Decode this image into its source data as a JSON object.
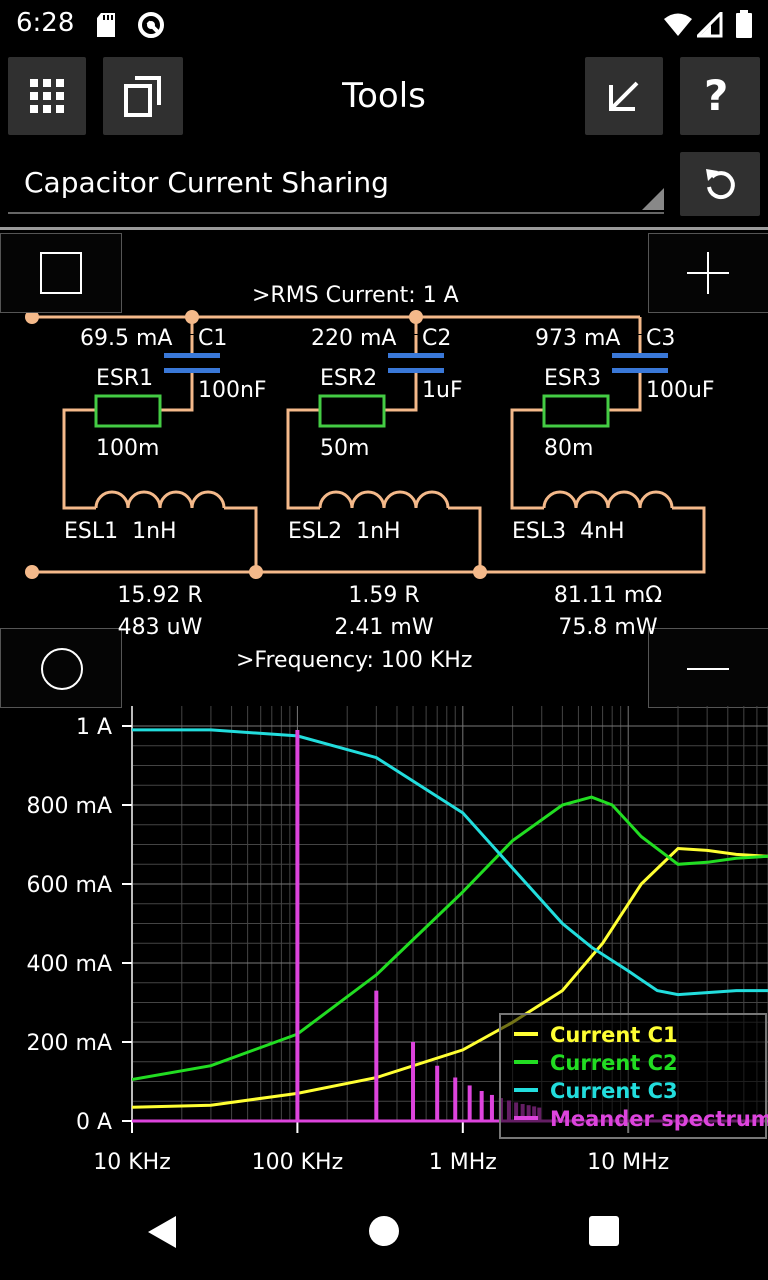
{
  "status_bar": {
    "time": "6:28"
  },
  "toolbar": {
    "title": "Tools"
  },
  "tool_select": {
    "value": "Capacitor Current Sharing"
  },
  "circuit": {
    "rms_current": ">RMS Current: 1 A",
    "frequency": ">Frequency: 100 KHz",
    "branches": [
      {
        "current": "69.5 mA",
        "cap_name": "C1",
        "cap_value": "100nF",
        "esr_name": "ESR1",
        "esr_value": "100m",
        "esl_label": "ESL1  1nH",
        "impedance": "15.92 R",
        "power": "483 uW"
      },
      {
        "current": "220 mA",
        "cap_name": "C2",
        "cap_value": "1uF",
        "esr_name": "ESR2",
        "esr_value": "50m",
        "esl_label": "ESL2  1nH",
        "impedance": "1.59 R",
        "power": "2.41 mW"
      },
      {
        "current": "973 mA",
        "cap_name": "C3",
        "cap_value": "100uF",
        "esr_name": "ESR3",
        "esr_value": "80m",
        "esl_label": "ESL3  4nH",
        "impedance": "81.11 mΩ",
        "power": "75.8 mW"
      }
    ]
  },
  "chart_data": {
    "type": "line",
    "x_scale": "log",
    "xlim": [
      10000,
      70000000
    ],
    "ylim": [
      0,
      1
    ],
    "x_ticks": [
      {
        "value": 10000,
        "label": "10 KHz"
      },
      {
        "value": 100000,
        "label": "100 KHz"
      },
      {
        "value": 1000000,
        "label": "1 MHz"
      },
      {
        "value": 10000000,
        "label": "10 MHz"
      }
    ],
    "y_ticks": [
      {
        "value": 0,
        "label": "0 A"
      },
      {
        "value": 0.2,
        "label": "200 mA"
      },
      {
        "value": 0.4,
        "label": "400 mA"
      },
      {
        "value": 0.6,
        "label": "600 mA"
      },
      {
        "value": 0.8,
        "label": "800 mA"
      },
      {
        "value": 1,
        "label": "1 A"
      }
    ],
    "grid": true,
    "legend_position": "bottom-right",
    "series": [
      {
        "name": "Current C1",
        "color": "#ffff33",
        "x": [
          10000,
          30000,
          100000,
          300000,
          1000000,
          2000000,
          4000000,
          7000000,
          12000000,
          20000000,
          30000000,
          45000000,
          70000000
        ],
        "y": [
          0.035,
          0.04,
          0.07,
          0.11,
          0.18,
          0.25,
          0.33,
          0.45,
          0.6,
          0.69,
          0.685,
          0.675,
          0.67
        ]
      },
      {
        "name": "Current C2",
        "color": "#22dd22",
        "x": [
          10000,
          30000,
          100000,
          300000,
          1000000,
          2000000,
          4000000,
          6000000,
          8000000,
          12000000,
          20000000,
          30000000,
          45000000,
          70000000
        ],
        "y": [
          0.105,
          0.14,
          0.22,
          0.37,
          0.58,
          0.71,
          0.8,
          0.82,
          0.8,
          0.72,
          0.65,
          0.655,
          0.665,
          0.67
        ]
      },
      {
        "name": "Current C3",
        "color": "#22dddd",
        "x": [
          10000,
          30000,
          100000,
          300000,
          1000000,
          2000000,
          4000000,
          6000000,
          10000000,
          15000000,
          20000000,
          30000000,
          45000000,
          70000000
        ],
        "y": [
          0.99,
          0.99,
          0.975,
          0.92,
          0.78,
          0.64,
          0.5,
          0.44,
          0.38,
          0.33,
          0.32,
          0.325,
          0.33,
          0.33
        ]
      },
      {
        "name": "Meander spectrum",
        "color": "#dd44dd",
        "type": "spectrum",
        "x": [
          100000,
          300000,
          500000,
          700000,
          900000,
          1100000,
          1300000,
          1500000,
          1700000,
          1900000,
          2100000,
          2300000,
          2500000,
          2700000,
          2900000
        ],
        "y": [
          0.99,
          0.33,
          0.2,
          0.14,
          0.11,
          0.09,
          0.076,
          0.066,
          0.058,
          0.052,
          0.047,
          0.043,
          0.04,
          0.037,
          0.034
        ]
      }
    ]
  }
}
